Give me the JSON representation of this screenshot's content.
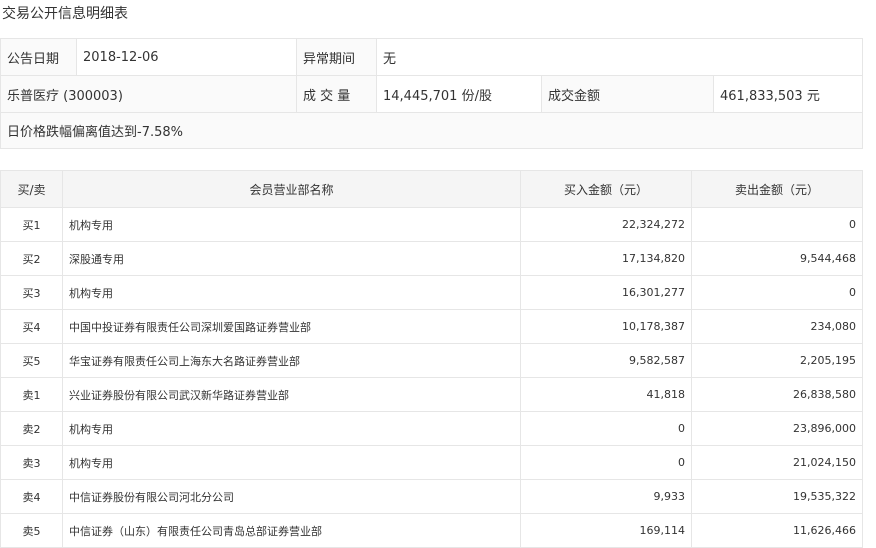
{
  "page_title": "交易公开信息明细表",
  "info": {
    "announce_date_label": "公告日期",
    "announce_date": "2018-12-06",
    "abnormal_period_label": "异常期间",
    "abnormal_period": "无",
    "stock": "乐普医疗 (300003)",
    "volume_label": "成 交 量",
    "volume": "14,445,701 份/股",
    "amount_label": "成交金额",
    "amount": "461,833,503 元",
    "note": "日价格跌幅偏离值达到-7.58%"
  },
  "table": {
    "headers": [
      "买/卖",
      "会员营业部名称",
      "买入金额（元）",
      "卖出金额（元）"
    ],
    "rows": [
      {
        "side": "买1",
        "name": "机构专用",
        "buy": "22,324,272",
        "sell": "0"
      },
      {
        "side": "买2",
        "name": "深股通专用",
        "buy": "17,134,820",
        "sell": "9,544,468"
      },
      {
        "side": "买3",
        "name": "机构专用",
        "buy": "16,301,277",
        "sell": "0"
      },
      {
        "side": "买4",
        "name": "中国中投证券有限责任公司深圳爱国路证券营业部",
        "buy": "10,178,387",
        "sell": "234,080"
      },
      {
        "side": "买5",
        "name": "华宝证券有限责任公司上海东大名路证券营业部",
        "buy": "9,582,587",
        "sell": "2,205,195"
      },
      {
        "side": "卖1",
        "name": "兴业证券股份有限公司武汉新华路证券营业部",
        "buy": "41,818",
        "sell": "26,838,580"
      },
      {
        "side": "卖2",
        "name": "机构专用",
        "buy": "0",
        "sell": "23,896,000"
      },
      {
        "side": "卖3",
        "name": "机构专用",
        "buy": "0",
        "sell": "21,024,150"
      },
      {
        "side": "卖4",
        "name": "中信证券股份有限公司河北分公司",
        "buy": "9,933",
        "sell": "19,535,322"
      },
      {
        "side": "卖5",
        "name": "中信证券（山东）有限责任公司青岛总部证券营业部",
        "buy": "169,114",
        "sell": "11,626,466"
      }
    ]
  }
}
